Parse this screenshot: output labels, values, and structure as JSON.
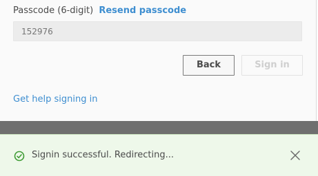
{
  "form": {
    "passcode_label": "Passcode (6-digit)",
    "resend_link": "Resend passcode",
    "passcode_placeholder": "152976",
    "back_label": "Back",
    "signin_label": "Sign in",
    "help_link": "Get help signing in"
  },
  "toast": {
    "message": "Signin successful. Redirecting...",
    "status": "success",
    "status_icon": "check-circle-icon",
    "close_icon": "close-icon"
  },
  "colors": {
    "link": "#3e8ed0",
    "success_icon": "#3f9c35",
    "toast_background": "#eef8ea",
    "overlay_band": "#6f6f6f"
  }
}
